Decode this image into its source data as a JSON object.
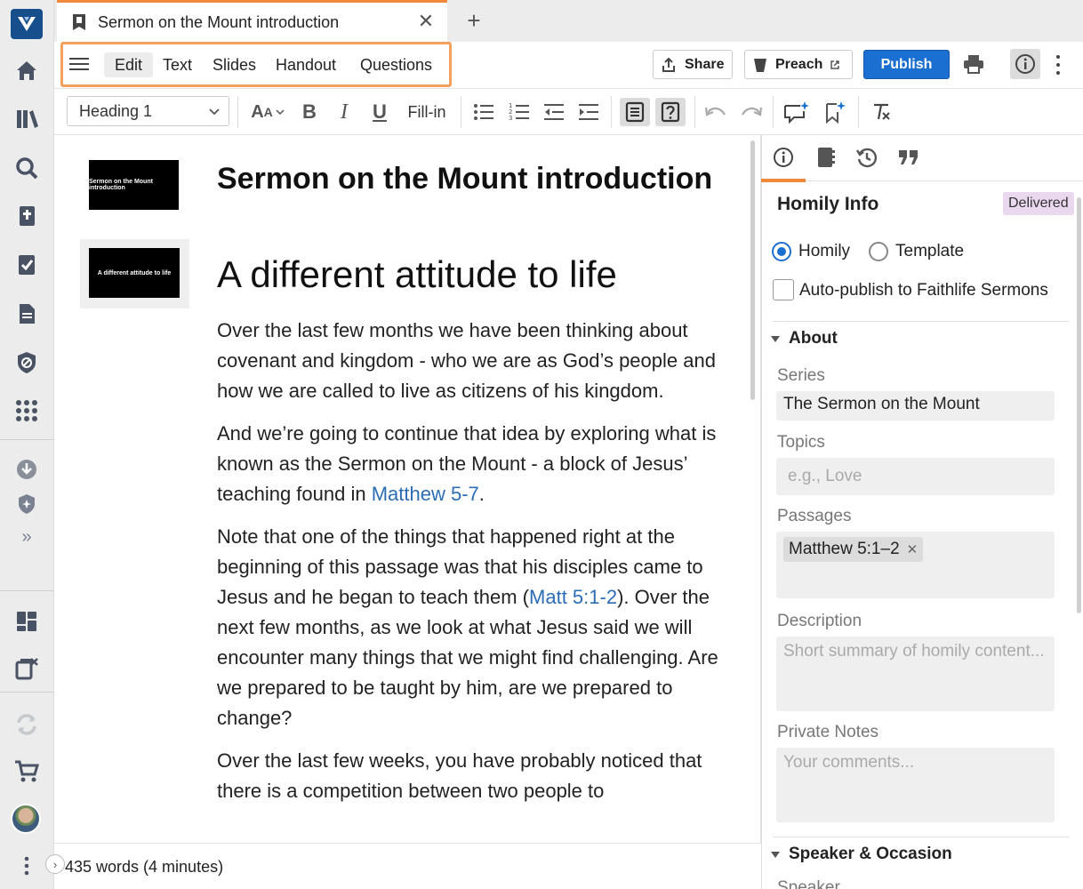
{
  "tab": {
    "title": "Sermon on the Mount introduction"
  },
  "menu": {
    "items": [
      "Edit",
      "Text",
      "Slides",
      "Handout",
      "Questions"
    ]
  },
  "toolbar": {
    "share_label": "Share",
    "preach_label": "Preach",
    "publish_label": "Publish"
  },
  "format": {
    "style_value": "Heading 1",
    "fill_in_label": "Fill-in"
  },
  "document": {
    "slide1_text": "Sermon on the Mount introduction",
    "slide2_text": "A different attitude to life",
    "title": "Sermon on the Mount introduction",
    "heading": "A different attitude to life",
    "p1": "Over the last few months we have been thinking about covenant and kingdom - who we are as God’s people and how we are called to live as citizens of his kingdom.",
    "p2_before": "And we’re going to continue that idea by exploring what is known as the Sermon on the Mount - a block of Jesus’ teaching found in ",
    "p2_link": "Matthew 5-7",
    "p2_after": ".",
    "p3_before": "Note that one of the things that happened right at the beginning of this passage was that his disciples came to Jesus and he began to teach them (",
    "p3_link": "Matt 5:1-2",
    "p3_after": "). Over the next few months, as we look at what Jesus said we will encounter many things that we might find challenging. Are we prepared to be taught by him, are we prepared to change?",
    "p4": "Over the last few weeks, you have probably noticed that there is a competition between two people to"
  },
  "status": {
    "word_count": "435 words (4 minutes)"
  },
  "panel": {
    "title": "Homily Info",
    "badge": "Delivered",
    "radio_homily": "Homily",
    "radio_template": "Template",
    "autopublish": "Auto-publish to Faithlife Sermons",
    "about": "About",
    "series_label": "Series",
    "series_value": "The Sermon on the Mount",
    "topics_label": "Topics",
    "topics_placeholder": "e.g., Love",
    "passages_label": "Passages",
    "passage_chip": "Matthew 5:1–2",
    "description_label": "Description",
    "description_placeholder": "Short summary of homily content...",
    "notes_label": "Private Notes",
    "notes_placeholder": "Your comments...",
    "speaker_section": "Speaker & Occasion",
    "speaker_partial": "Speaker"
  },
  "colors": {
    "accent": "#f0883a",
    "primary": "#1a6fd0",
    "link": "#2c6cb5",
    "badge_bg": "#ead8ef"
  }
}
